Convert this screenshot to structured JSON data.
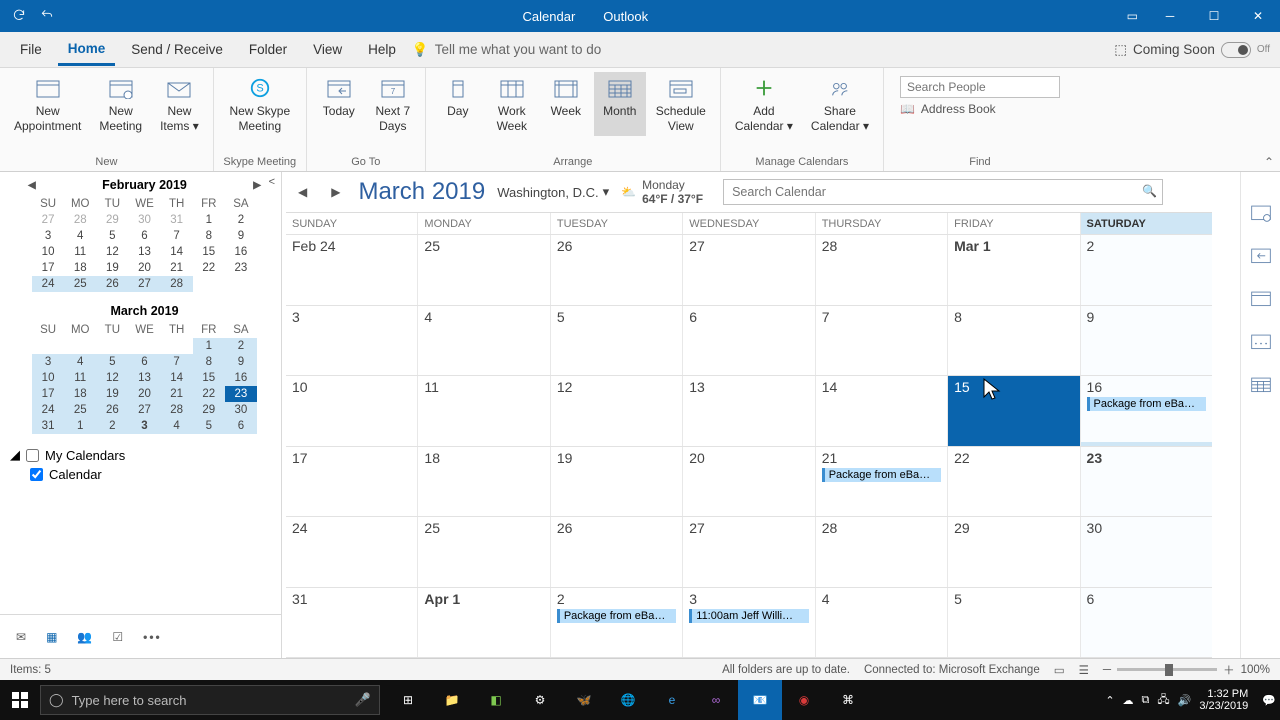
{
  "titlebar": {
    "app": "Calendar",
    "suffix": "Outlook"
  },
  "menu": {
    "file": "File",
    "home": "Home",
    "sendreceive": "Send / Receive",
    "folder": "Folder",
    "view": "View",
    "help": "Help",
    "tellme": "Tell me what you want to do",
    "coming": "Coming Soon",
    "switch": "Off"
  },
  "ribbon": {
    "new": {
      "label": "New",
      "appt1": "New",
      "appt2": "Appointment",
      "meet1": "New",
      "meet2": "Meeting",
      "items1": "New",
      "items2": "Items ▾"
    },
    "skype": {
      "label": "Skype Meeting",
      "btn1": "New Skype",
      "btn2": "Meeting"
    },
    "goto": {
      "label": "Go To",
      "today": "Today",
      "next1": "Next 7",
      "next2": "Days"
    },
    "arrange": {
      "label": "Arrange",
      "day": "Day",
      "work1": "Work",
      "work2": "Week",
      "week": "Week",
      "month": "Month",
      "sched1": "Schedule",
      "sched2": "View"
    },
    "manage": {
      "label": "Manage Calendars",
      "add1": "Add",
      "add2": "Calendar ▾",
      "share1": "Share",
      "share2": "Calendar ▾"
    },
    "find": {
      "label": "Find",
      "search_ph": "Search People",
      "addr": "Address Book"
    }
  },
  "mini": {
    "feb": {
      "title": "February 2019",
      "dow": [
        "SU",
        "MO",
        "TU",
        "WE",
        "TH",
        "FR",
        "SA"
      ],
      "rows": [
        [
          {
            "d": "27",
            "o": true
          },
          {
            "d": "28",
            "o": true
          },
          {
            "d": "29",
            "o": true
          },
          {
            "d": "30",
            "o": true
          },
          {
            "d": "31",
            "o": true
          },
          {
            "d": "1"
          },
          {
            "d": "2"
          }
        ],
        [
          {
            "d": "3"
          },
          {
            "d": "4"
          },
          {
            "d": "5"
          },
          {
            "d": "6"
          },
          {
            "d": "7"
          },
          {
            "d": "8"
          },
          {
            "d": "9"
          }
        ],
        [
          {
            "d": "10"
          },
          {
            "d": "11"
          },
          {
            "d": "12"
          },
          {
            "d": "13"
          },
          {
            "d": "14"
          },
          {
            "d": "15"
          },
          {
            "d": "16"
          }
        ],
        [
          {
            "d": "17"
          },
          {
            "d": "18"
          },
          {
            "d": "19"
          },
          {
            "d": "20"
          },
          {
            "d": "21"
          },
          {
            "d": "22"
          },
          {
            "d": "23"
          }
        ],
        [
          {
            "d": "24",
            "hl": true
          },
          {
            "d": "25",
            "hl": true
          },
          {
            "d": "26",
            "hl": true
          },
          {
            "d": "27",
            "hl": true
          },
          {
            "d": "28",
            "hl": true
          },
          {
            "d": ""
          },
          {
            "d": ""
          }
        ]
      ]
    },
    "mar": {
      "title": "March 2019",
      "dow": [
        "SU",
        "MO",
        "TU",
        "WE",
        "TH",
        "FR",
        "SA"
      ],
      "rows": [
        [
          {
            "d": ""
          },
          {
            "d": ""
          },
          {
            "d": ""
          },
          {
            "d": ""
          },
          {
            "d": ""
          },
          {
            "d": "1",
            "hl": true
          },
          {
            "d": "2",
            "hl": true
          }
        ],
        [
          {
            "d": "3",
            "hl": true
          },
          {
            "d": "4",
            "hl": true
          },
          {
            "d": "5",
            "hl": true
          },
          {
            "d": "6",
            "hl": true
          },
          {
            "d": "7",
            "hl": true
          },
          {
            "d": "8",
            "hl": true
          },
          {
            "d": "9",
            "hl": true
          }
        ],
        [
          {
            "d": "10",
            "hl": true
          },
          {
            "d": "11",
            "hl": true
          },
          {
            "d": "12",
            "hl": true
          },
          {
            "d": "13",
            "hl": true
          },
          {
            "d": "14",
            "hl": true
          },
          {
            "d": "15",
            "hl": true
          },
          {
            "d": "16",
            "hl": true
          }
        ],
        [
          {
            "d": "17",
            "hl": true
          },
          {
            "d": "18",
            "hl": true
          },
          {
            "d": "19",
            "hl": true
          },
          {
            "d": "20",
            "hl": true
          },
          {
            "d": "21",
            "hl": true
          },
          {
            "d": "22",
            "hl": true
          },
          {
            "d": "23",
            "today": true
          }
        ],
        [
          {
            "d": "24",
            "hl": true
          },
          {
            "d": "25",
            "hl": true
          },
          {
            "d": "26",
            "hl": true
          },
          {
            "d": "27",
            "hl": true
          },
          {
            "d": "28",
            "hl": true
          },
          {
            "d": "29",
            "hl": true
          },
          {
            "d": "30",
            "hl": true
          }
        ],
        [
          {
            "d": "31",
            "hl": true
          },
          {
            "d": "1",
            "hl": true
          },
          {
            "d": "2",
            "hl": true
          },
          {
            "d": "3",
            "hl": true,
            "b": true
          },
          {
            "d": "4",
            "hl": true
          },
          {
            "d": "5",
            "hl": true
          },
          {
            "d": "6",
            "hl": true
          }
        ]
      ]
    }
  },
  "mycals": {
    "title": "My Calendars",
    "item1": "Calendar"
  },
  "calheader": {
    "title": "March 2019",
    "location": "Washington,  D.C.",
    "weather_day": "Monday",
    "weather_temp": "64°F / 37°F",
    "search_ph": "Search Calendar"
  },
  "daynames": [
    "SUNDAY",
    "MONDAY",
    "TUESDAY",
    "WEDNESDAY",
    "THURSDAY",
    "FRIDAY",
    "SATURDAY"
  ],
  "grid": [
    [
      {
        "t": "Feb 24"
      },
      {
        "t": "25"
      },
      {
        "t": "26"
      },
      {
        "t": "27"
      },
      {
        "t": "28"
      },
      {
        "t": "Mar 1",
        "nm": true
      },
      {
        "t": "2"
      }
    ],
    [
      {
        "t": "3"
      },
      {
        "t": "4"
      },
      {
        "t": "5"
      },
      {
        "t": "6"
      },
      {
        "t": "7"
      },
      {
        "t": "8"
      },
      {
        "t": "9"
      }
    ],
    [
      {
        "t": "10"
      },
      {
        "t": "11"
      },
      {
        "t": "12"
      },
      {
        "t": "13"
      },
      {
        "t": "14"
      },
      {
        "t": "15",
        "sel": true
      },
      {
        "t": "16",
        "ev": "Package from eBa…",
        "satunder": true
      }
    ],
    [
      {
        "t": "17"
      },
      {
        "t": "18"
      },
      {
        "t": "19"
      },
      {
        "t": "20"
      },
      {
        "t": "21",
        "ev": "Package from eBa…"
      },
      {
        "t": "22"
      },
      {
        "t": "23",
        "today": true
      }
    ],
    [
      {
        "t": "24"
      },
      {
        "t": "25"
      },
      {
        "t": "26"
      },
      {
        "t": "27"
      },
      {
        "t": "28"
      },
      {
        "t": "29"
      },
      {
        "t": "30"
      }
    ],
    [
      {
        "t": "31"
      },
      {
        "t": "Apr 1",
        "nm": true
      },
      {
        "t": "2",
        "ev": "Package from eBa…"
      },
      {
        "t": "3",
        "ev": "11:00am Jeff Willi…"
      },
      {
        "t": "4"
      },
      {
        "t": "5"
      },
      {
        "t": "6"
      }
    ]
  ],
  "status": {
    "items": "Items: 5",
    "folders": "All folders are up to date.",
    "conn": "Connected to: Microsoft Exchange",
    "zoom": "100%"
  },
  "taskbar": {
    "search_ph": "Type here to search",
    "time": "1:32 PM",
    "date": "3/23/2019"
  }
}
